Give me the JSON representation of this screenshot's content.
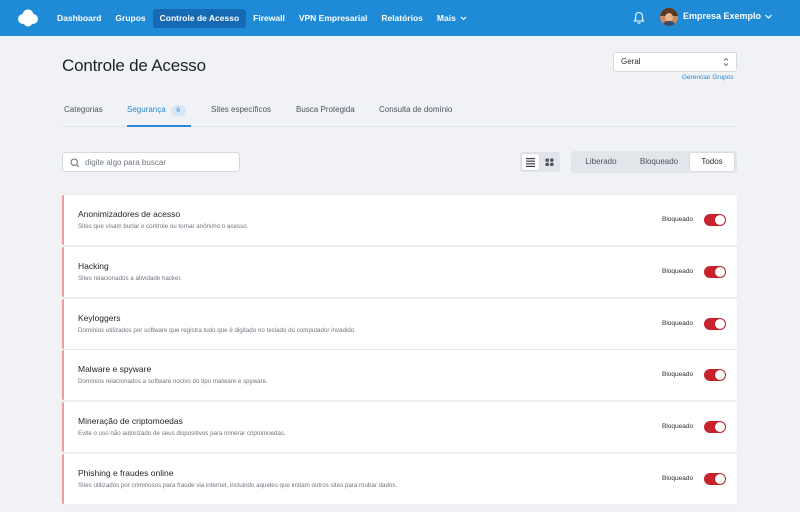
{
  "nav": {
    "items": [
      {
        "label": "Dashboard"
      },
      {
        "label": "Grupos"
      },
      {
        "label": "Controle de Acesso"
      },
      {
        "label": "Firewall"
      },
      {
        "label": "VPN Empresarial"
      },
      {
        "label": "Relatórios"
      },
      {
        "label": "Mais"
      }
    ],
    "account_name": "Empresa Exemplo",
    "brand_color": "#1f8ad6"
  },
  "page": {
    "title": "Controle de Acesso",
    "group_select": "Geral",
    "manage_groups_link": "Gerenciar Grupos"
  },
  "tabs": [
    {
      "label": "Categorias"
    },
    {
      "label": "Segurança",
      "badge": "6"
    },
    {
      "label": "Sites específicos"
    },
    {
      "label": "Busca Protegida"
    },
    {
      "label": "Consulta de domínio"
    }
  ],
  "search": {
    "placeholder": "digite algo para buscar"
  },
  "filter": {
    "options": [
      "Liberado",
      "Bloqueado",
      "Todos"
    ],
    "selected": "Todos"
  },
  "categories": [
    {
      "title": "Anonimizadores de acesso",
      "description": "Sites que visam burlar o controle ou tornar anônimo o acesso.",
      "status": "Bloqueado",
      "blocked": true
    },
    {
      "title": "Hacking",
      "description": "Sites relacionados a atividade hacker.",
      "status": "Bloqueado",
      "blocked": true
    },
    {
      "title": "Keyloggers",
      "description": "Domínios utilizados por software que registra tudo que é digitado no teclado do computador invadido.",
      "status": "Bloqueado",
      "blocked": true
    },
    {
      "title": "Malware e spyware",
      "description": "Domínios relacionados a software nocivo do tipo malware e spyware.",
      "status": "Bloqueado",
      "blocked": true
    },
    {
      "title": "Mineração de criptomoedas",
      "description": "Evite o uso não autorizado de seus dispositivos para minerar criptomoedas.",
      "status": "Bloqueado",
      "blocked": true
    },
    {
      "title": "Phishing e fraudes online",
      "description": "Sites utilizados por criminosos para fraude via internet, incluindo aqueles que imitam outros sites para roubar dados.",
      "status": "Bloqueado",
      "blocked": true
    }
  ],
  "colors": {
    "blocked_toggle": "#c8232c",
    "accent": "#2a88d4",
    "card_edge": "#ef9ea0"
  }
}
